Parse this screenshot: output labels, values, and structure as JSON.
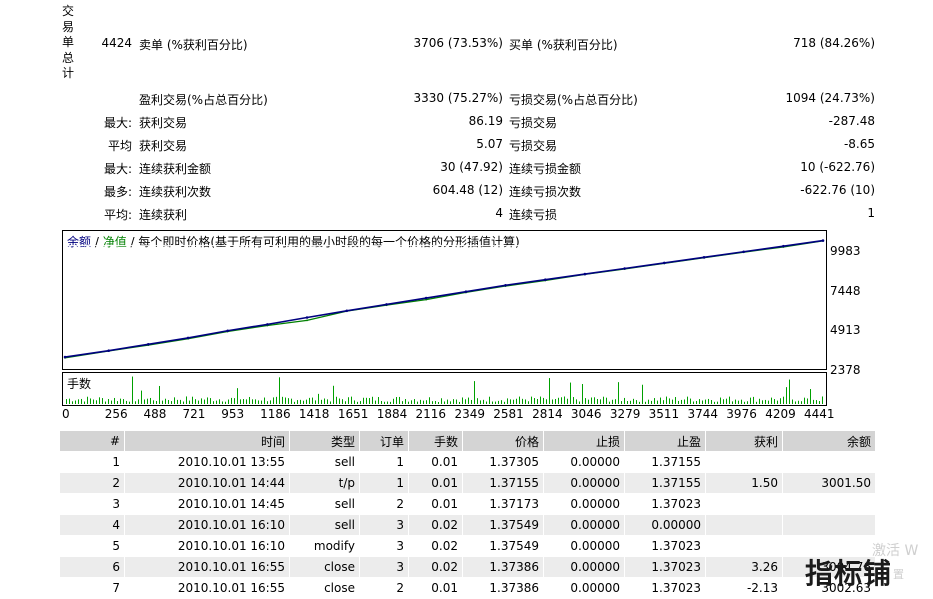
{
  "summary": {
    "vertical_label": "交易单总计",
    "total_trades": "4424",
    "sell_label": "卖单 (%获利百分比)",
    "sell_value": "3706 (73.53%)",
    "buy_label": "买单 (%获利百分比)",
    "buy_value": "718 (84.26%)",
    "rows": [
      {
        "prefix": "",
        "left_label": "盈利交易(%占总百分比)",
        "left_value": "3330 (75.27%)",
        "right_label": "亏损交易(%占总百分比)",
        "right_value": "1094 (24.73%)"
      },
      {
        "prefix": "最大:",
        "left_label": "获利交易",
        "left_value": "86.19",
        "right_label": "亏损交易",
        "right_value": "-287.48"
      },
      {
        "prefix": "平均",
        "left_label": "获利交易",
        "left_value": "5.07",
        "right_label": "亏损交易",
        "right_value": "-8.65"
      },
      {
        "prefix": "最大:",
        "left_label": "连续获利金额",
        "left_value": "30 (47.92)",
        "right_label": "连续亏损金额",
        "right_value": "10 (-622.76)"
      },
      {
        "prefix": "最多:",
        "left_label": "连续获利次数",
        "left_value": "604.48 (12)",
        "right_label": "连续亏损次数",
        "right_value": "-622.76 (10)"
      },
      {
        "prefix": "平均:",
        "left_label": "连续获利",
        "left_value": "4",
        "right_label": "连续亏损",
        "right_value": "1"
      }
    ]
  },
  "chart": {
    "legend_balance": "余额",
    "legend_sep1": " / ",
    "legend_equity": "净值",
    "legend_sep2": " / ",
    "legend_desc": "每个即时价格(基于所有可利用的最小时段的每一个价格的分形插值计算)",
    "volume_label": "手数",
    "balance_color": "#000080",
    "equity_color": "#008000",
    "y_ticks": [
      "9983",
      "7448",
      "4913",
      "2378"
    ],
    "x_ticks": [
      "0",
      "256",
      "488",
      "721",
      "953",
      "1186",
      "1418",
      "1651",
      "1884",
      "2116",
      "2349",
      "2581",
      "2814",
      "3046",
      "3279",
      "3511",
      "3744",
      "3976",
      "4209",
      "4441"
    ]
  },
  "chart_data": {
    "type": "line",
    "x": [
      0,
      256,
      488,
      721,
      953,
      1186,
      1418,
      1651,
      1884,
      2116,
      2349,
      2581,
      2814,
      3046,
      3279,
      3511,
      3744,
      3976,
      4209,
      4441
    ],
    "series": [
      {
        "name": "余额",
        "values": [
          3001,
          3400,
          3800,
          4200,
          4650,
          5050,
          5480,
          5900,
          6300,
          6700,
          7100,
          7500,
          7850,
          8200,
          8550,
          8900,
          9250,
          9600,
          9950,
          10300
        ]
      },
      {
        "name": "净值",
        "values": [
          2950,
          3380,
          3750,
          4150,
          4600,
          4980,
          5300,
          5880,
          6250,
          6600,
          7050,
          7450,
          7800,
          8180,
          8520,
          8870,
          9220,
          9570,
          9900,
          10280
        ]
      }
    ],
    "ylim": [
      2378,
      10400
    ],
    "yticks": [
      2378,
      4913,
      7448,
      9983
    ]
  },
  "table": {
    "headers": [
      "#",
      "时间",
      "类型",
      "订单",
      "手数",
      "价格",
      "止损",
      "止盈",
      "获利",
      "余额"
    ],
    "rows": [
      [
        "1",
        "2010.10.01 13:55",
        "sell",
        "1",
        "0.01",
        "1.37305",
        "0.00000",
        "1.37155",
        "",
        ""
      ],
      [
        "2",
        "2010.10.01 14:44",
        "t/p",
        "1",
        "0.01",
        "1.37155",
        "0.00000",
        "1.37155",
        "1.50",
        "3001.50"
      ],
      [
        "3",
        "2010.10.01 14:45",
        "sell",
        "2",
        "0.01",
        "1.37173",
        "0.00000",
        "1.37023",
        "",
        ""
      ],
      [
        "4",
        "2010.10.01 16:10",
        "sell",
        "3",
        "0.02",
        "1.37549",
        "0.00000",
        "0.00000",
        "",
        ""
      ],
      [
        "5",
        "2010.10.01 16:10",
        "modify",
        "3",
        "0.02",
        "1.37549",
        "0.00000",
        "1.37023",
        "",
        ""
      ],
      [
        "6",
        "2010.10.01 16:55",
        "close",
        "3",
        "0.02",
        "1.37386",
        "0.00000",
        "1.37023",
        "3.26",
        "3004.76"
      ],
      [
        "7",
        "2010.10.01 16:55",
        "close",
        "2",
        "0.01",
        "1.37386",
        "0.00000",
        "1.37023",
        "-2.13",
        "3002.63"
      ]
    ]
  },
  "watermark": {
    "line1": "激活 W",
    "brand": "指标铺",
    "line3": "置"
  }
}
